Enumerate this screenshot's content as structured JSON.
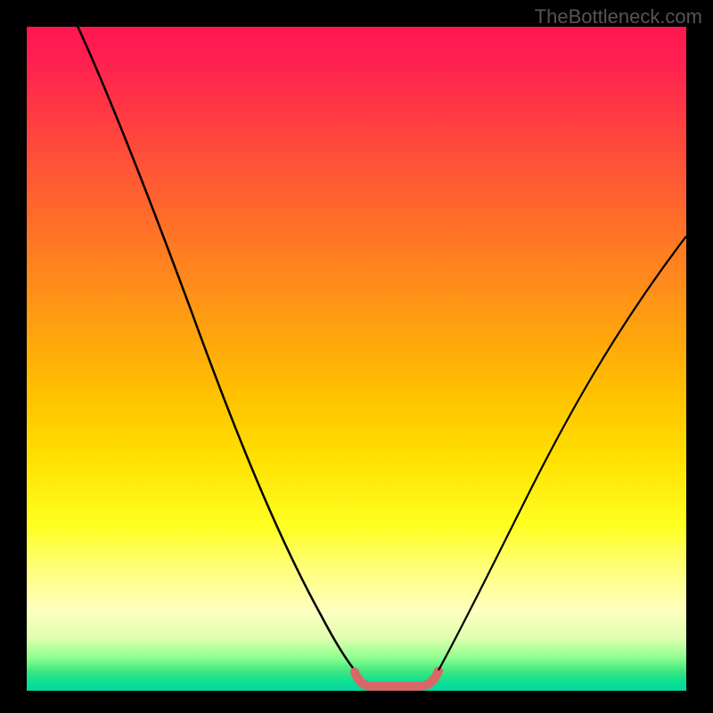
{
  "watermark": "TheBottleneck.com",
  "chart_data": {
    "type": "line",
    "title": "",
    "xlabel": "",
    "ylabel": "",
    "xlim": [
      0,
      100
    ],
    "ylim": [
      0,
      100
    ],
    "grid": false,
    "series": [
      {
        "name": "bottleneck-curve-left",
        "color": "#000000",
        "x": [
          8,
          15,
          22,
          30,
          38,
          44,
          48,
          50
        ],
        "y": [
          100,
          85,
          70,
          52,
          32,
          14,
          4,
          1
        ]
      },
      {
        "name": "bottom-flat-highlight",
        "color": "#e07070",
        "x": [
          49,
          51,
          53,
          56,
          59,
          61,
          62
        ],
        "y": [
          2,
          0.5,
          0.5,
          0.5,
          0.5,
          0.5,
          2
        ]
      },
      {
        "name": "bottleneck-curve-right",
        "color": "#000000",
        "x": [
          62,
          68,
          75,
          82,
          90,
          98,
          100
        ],
        "y": [
          3,
          12,
          25,
          38,
          52,
          64,
          67
        ]
      }
    ],
    "gradient_stops": [
      {
        "pos": 0,
        "color": "#ff1650"
      },
      {
        "pos": 50,
        "color": "#ffc000"
      },
      {
        "pos": 80,
        "color": "#ffff60"
      },
      {
        "pos": 100,
        "color": "#00d8a0"
      }
    ]
  }
}
